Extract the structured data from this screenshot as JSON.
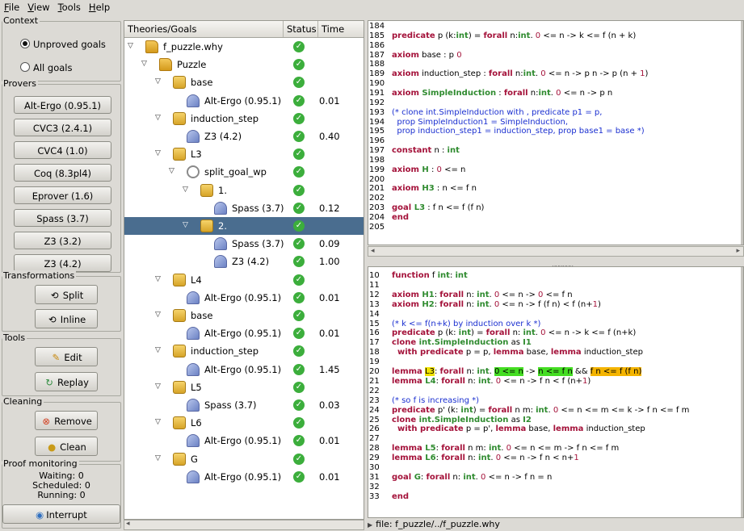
{
  "menu": [
    "File",
    "View",
    "Tools",
    "Help"
  ],
  "context": {
    "title": "Context",
    "options": [
      {
        "label": "Unproved goals",
        "selected": true
      },
      {
        "label": "All goals",
        "selected": false
      }
    ]
  },
  "provers": {
    "title": "Provers",
    "buttons": [
      "Alt-Ergo (0.95.1)",
      "CVC3 (2.4.1)",
      "CVC4 (1.0)",
      "Coq (8.3pl4)",
      "Eprover (1.6)",
      "Spass (3.7)",
      "Z3 (3.2)",
      "Z3 (4.2)"
    ]
  },
  "transformations": {
    "title": "Transformations",
    "buttons": [
      {
        "label": "Split",
        "icon": "split-icon"
      },
      {
        "label": "Inline",
        "icon": "inline-icon"
      }
    ]
  },
  "tools": {
    "title": "Tools",
    "buttons": [
      {
        "label": "Edit",
        "icon": "pencil-icon"
      },
      {
        "label": "Replay",
        "icon": "replay-icon"
      }
    ]
  },
  "cleaning": {
    "title": "Cleaning",
    "buttons": [
      {
        "label": "Remove",
        "icon": "remove-icon"
      },
      {
        "label": "Clean",
        "icon": "clean-icon"
      }
    ]
  },
  "monitor": {
    "title": "Proof monitoring",
    "waiting": "Waiting: 0",
    "scheduled": "Scheduled: 0",
    "running": "Running: 0",
    "interrupt": "Interrupt"
  },
  "tree": {
    "headers": [
      "Theories/Goals",
      "Status",
      "Time"
    ],
    "rows": [
      {
        "label": "f_puzzle.why",
        "icon": "folder-icon",
        "depth": 0,
        "expander": "▽",
        "time": ""
      },
      {
        "label": "Puzzle",
        "icon": "folder-icon",
        "depth": 1,
        "expander": "▽",
        "time": ""
      },
      {
        "label": "base",
        "icon": "lock-icon",
        "depth": 2,
        "expander": "▽",
        "time": ""
      },
      {
        "label": "Alt-Ergo (0.95.1)",
        "icon": "prover-icon",
        "depth": 3,
        "expander": "",
        "time": "0.01"
      },
      {
        "label": "induction_step",
        "icon": "lock-icon",
        "depth": 2,
        "expander": "▽",
        "time": ""
      },
      {
        "label": "Z3 (4.2)",
        "icon": "prover-icon",
        "depth": 3,
        "expander": "",
        "time": "0.40"
      },
      {
        "label": "L3",
        "icon": "lock-icon",
        "depth": 2,
        "expander": "▽",
        "time": ""
      },
      {
        "label": "split_goal_wp",
        "icon": "split-icon",
        "depth": 3,
        "expander": "▽",
        "time": ""
      },
      {
        "label": "1.",
        "icon": "lock-icon",
        "depth": 4,
        "expander": "▽",
        "time": ""
      },
      {
        "label": "Spass (3.7)",
        "icon": "prover-icon",
        "depth": 5,
        "expander": "",
        "time": "0.12"
      },
      {
        "label": "2.",
        "icon": "lock-icon",
        "depth": 4,
        "expander": "▽",
        "time": "",
        "selected": true
      },
      {
        "label": "Spass (3.7)",
        "icon": "prover-icon",
        "depth": 5,
        "expander": "",
        "time": "0.09"
      },
      {
        "label": "Z3 (4.2)",
        "icon": "prover-icon",
        "depth": 5,
        "expander": "",
        "time": "1.00"
      },
      {
        "label": "L4",
        "icon": "lock-icon",
        "depth": 2,
        "expander": "▽",
        "time": ""
      },
      {
        "label": "Alt-Ergo (0.95.1)",
        "icon": "prover-icon",
        "depth": 3,
        "expander": "",
        "time": "0.01"
      },
      {
        "label": "base",
        "icon": "lock-icon",
        "depth": 2,
        "expander": "▽",
        "time": ""
      },
      {
        "label": "Alt-Ergo (0.95.1)",
        "icon": "prover-icon",
        "depth": 3,
        "expander": "",
        "time": "0.01"
      },
      {
        "label": "induction_step",
        "icon": "lock-icon",
        "depth": 2,
        "expander": "▽",
        "time": ""
      },
      {
        "label": "Alt-Ergo (0.95.1)",
        "icon": "prover-icon",
        "depth": 3,
        "expander": "",
        "time": "1.45"
      },
      {
        "label": "L5",
        "icon": "lock-icon",
        "depth": 2,
        "expander": "▽",
        "time": ""
      },
      {
        "label": "Spass (3.7)",
        "icon": "prover-icon",
        "depth": 3,
        "expander": "",
        "time": "0.03"
      },
      {
        "label": "L6",
        "icon": "lock-icon",
        "depth": 2,
        "expander": "▽",
        "time": ""
      },
      {
        "label": "Alt-Ergo (0.95.1)",
        "icon": "prover-icon",
        "depth": 3,
        "expander": "",
        "time": "0.01"
      },
      {
        "label": "G",
        "icon": "lock-icon",
        "depth": 2,
        "expander": "▽",
        "time": ""
      },
      {
        "label": "Alt-Ergo (0.95.1)",
        "icon": "prover-icon",
        "depth": 3,
        "expander": "",
        "time": "0.01"
      }
    ]
  },
  "task_view": {
    "lines": [
      {
        "n": "184",
        "segs": []
      },
      {
        "n": "185",
        "segs": [
          [
            "k",
            "predicate"
          ],
          [
            "d",
            " p (k:"
          ],
          [
            "t",
            "int"
          ],
          [
            "d",
            ") = "
          ],
          [
            "k",
            "forall"
          ],
          [
            "d",
            " n:"
          ],
          [
            "t",
            "int"
          ],
          [
            "d",
            ". "
          ],
          [
            "nm",
            "0"
          ],
          [
            "d",
            " <= n -> k <= f (n + k)"
          ]
        ]
      },
      {
        "n": "186",
        "segs": []
      },
      {
        "n": "187",
        "segs": [
          [
            "k",
            "axiom"
          ],
          [
            "d",
            " base : p "
          ],
          [
            "nm",
            "0"
          ]
        ]
      },
      {
        "n": "188",
        "segs": []
      },
      {
        "n": "189",
        "segs": [
          [
            "k",
            "axiom"
          ],
          [
            "d",
            " induction_step : "
          ],
          [
            "k",
            "forall"
          ],
          [
            "d",
            " n:"
          ],
          [
            "t",
            "int"
          ],
          [
            "d",
            ". "
          ],
          [
            "nm",
            "0"
          ],
          [
            "d",
            " <= n -> p n -> p (n + "
          ],
          [
            "nm",
            "1"
          ],
          [
            "d",
            ")"
          ]
        ]
      },
      {
        "n": "190",
        "segs": []
      },
      {
        "n": "191",
        "segs": [
          [
            "k",
            "axiom"
          ],
          [
            "t",
            " SimpleInduction"
          ],
          [
            "d",
            " : "
          ],
          [
            "k",
            "forall"
          ],
          [
            "d",
            " n:"
          ],
          [
            "t",
            "int"
          ],
          [
            "d",
            ". "
          ],
          [
            "nm",
            "0"
          ],
          [
            "d",
            " <= n -> p n"
          ]
        ]
      },
      {
        "n": "192",
        "segs": []
      },
      {
        "n": "193",
        "segs": [
          [
            "cm",
            "(* clone int.SimpleInduction with , predicate p1 = p,"
          ]
        ]
      },
      {
        "n": "194",
        "segs": [
          [
            "cm",
            "  prop SimpleInduction1 = SimpleInduction,"
          ]
        ]
      },
      {
        "n": "195",
        "segs": [
          [
            "cm",
            "  prop induction_step1 = induction_step, prop base1 = base *)"
          ]
        ]
      },
      {
        "n": "196",
        "segs": []
      },
      {
        "n": "197",
        "segs": [
          [
            "k",
            "constant"
          ],
          [
            "d",
            " n : "
          ],
          [
            "t",
            "int"
          ]
        ]
      },
      {
        "n": "198",
        "segs": []
      },
      {
        "n": "199",
        "segs": [
          [
            "k",
            "axiom"
          ],
          [
            "t",
            " H"
          ],
          [
            "d",
            " : "
          ],
          [
            "nm",
            "0"
          ],
          [
            "d",
            " <= n"
          ]
        ]
      },
      {
        "n": "200",
        "segs": []
      },
      {
        "n": "201",
        "segs": [
          [
            "k",
            "axiom"
          ],
          [
            "t",
            " H3"
          ],
          [
            "d",
            " : n <= f n"
          ]
        ]
      },
      {
        "n": "202",
        "segs": []
      },
      {
        "n": "203",
        "segs": [
          [
            "k",
            "goal"
          ],
          [
            "t",
            " L3"
          ],
          [
            "d",
            " : f n <= f (f n)"
          ]
        ]
      },
      {
        "n": "204",
        "segs": [
          [
            "k",
            "end"
          ]
        ]
      },
      {
        "n": "205",
        "segs": []
      }
    ]
  },
  "source_view": {
    "lines": [
      {
        "n": "10",
        "segs": [
          [
            "k",
            "function"
          ],
          [
            "d",
            " f "
          ],
          [
            "t",
            "int"
          ],
          [
            "d",
            ": "
          ],
          [
            "t",
            "int"
          ]
        ]
      },
      {
        "n": "11",
        "segs": []
      },
      {
        "n": "12",
        "segs": [
          [
            "k",
            "axiom"
          ],
          [
            "t",
            " H1"
          ],
          [
            "d",
            ": "
          ],
          [
            "k",
            "forall"
          ],
          [
            "d",
            " n: "
          ],
          [
            "t",
            "int"
          ],
          [
            "d",
            ". "
          ],
          [
            "nm",
            "0"
          ],
          [
            "d",
            " <= n -> "
          ],
          [
            "nm",
            "0"
          ],
          [
            "d",
            " <= f n"
          ]
        ]
      },
      {
        "n": "13",
        "segs": [
          [
            "k",
            "axiom"
          ],
          [
            "t",
            " H2"
          ],
          [
            "d",
            ": "
          ],
          [
            "k",
            "forall"
          ],
          [
            "d",
            " n: "
          ],
          [
            "t",
            "int"
          ],
          [
            "d",
            ". "
          ],
          [
            "nm",
            "0"
          ],
          [
            "d",
            " <= n -> f (f n) < f (n+"
          ],
          [
            "nm",
            "1"
          ],
          [
            "d",
            ")"
          ]
        ]
      },
      {
        "n": "14",
        "segs": []
      },
      {
        "n": "15",
        "segs": [
          [
            "cm",
            "(* k <= f(n+k) by induction over k *)"
          ]
        ]
      },
      {
        "n": "16",
        "segs": [
          [
            "k",
            "predicate"
          ],
          [
            "d",
            " p (k: "
          ],
          [
            "t",
            "int"
          ],
          [
            "d",
            ") = "
          ],
          [
            "k",
            "forall"
          ],
          [
            "d",
            " n: "
          ],
          [
            "t",
            "int"
          ],
          [
            "d",
            ". "
          ],
          [
            "nm",
            "0"
          ],
          [
            "d",
            " <= n -> k <= f (n+k)"
          ]
        ]
      },
      {
        "n": "17",
        "segs": [
          [
            "k",
            "clone"
          ],
          [
            "t",
            " int.SimpleInduction"
          ],
          [
            "d",
            " as "
          ],
          [
            "t",
            "I1"
          ]
        ]
      },
      {
        "n": "18",
        "segs": [
          [
            "k",
            "  with predicate"
          ],
          [
            "d",
            " p = p, "
          ],
          [
            "k",
            "lemma"
          ],
          [
            "d",
            " base, "
          ],
          [
            "k",
            "lemma"
          ],
          [
            "d",
            " induction_step"
          ]
        ]
      },
      {
        "n": "19",
        "segs": []
      },
      {
        "n": "20",
        "segs": [
          [
            "k",
            "lemma"
          ],
          [
            "d",
            " "
          ],
          [
            "hY",
            "L3"
          ],
          [
            "d",
            ": "
          ],
          [
            "k",
            "forall"
          ],
          [
            "d",
            " n: "
          ],
          [
            "t",
            "int"
          ],
          [
            "d",
            ". "
          ],
          [
            "hG",
            "0 <= n"
          ],
          [
            "d",
            " -> "
          ],
          [
            "hG",
            "n <= f n"
          ],
          [
            "d",
            " && "
          ],
          [
            "hO",
            "f n <= f (f n)"
          ]
        ]
      },
      {
        "n": "21",
        "segs": [
          [
            "k",
            "lemma"
          ],
          [
            "t",
            " L4"
          ],
          [
            "d",
            ": "
          ],
          [
            "k",
            "forall"
          ],
          [
            "d",
            " n: "
          ],
          [
            "t",
            "int"
          ],
          [
            "d",
            ". "
          ],
          [
            "nm",
            "0"
          ],
          [
            "d",
            " <= n -> f n < f (n+"
          ],
          [
            "nm",
            "1"
          ],
          [
            "d",
            ")"
          ]
        ]
      },
      {
        "n": "22",
        "segs": []
      },
      {
        "n": "23",
        "segs": [
          [
            "cm",
            "(* so f is increasing *)"
          ]
        ]
      },
      {
        "n": "24",
        "segs": [
          [
            "k",
            "predicate"
          ],
          [
            "d",
            " p' (k: "
          ],
          [
            "t",
            "int"
          ],
          [
            "d",
            ") = "
          ],
          [
            "k",
            "forall"
          ],
          [
            "d",
            " n m: "
          ],
          [
            "t",
            "int"
          ],
          [
            "d",
            ". "
          ],
          [
            "nm",
            "0"
          ],
          [
            "d",
            " <= n <= m <= k -> f n <= f m"
          ]
        ]
      },
      {
        "n": "25",
        "segs": [
          [
            "k",
            "clone"
          ],
          [
            "t",
            " int.SimpleInduction"
          ],
          [
            "d",
            " as "
          ],
          [
            "t",
            "I2"
          ]
        ]
      },
      {
        "n": "26",
        "segs": [
          [
            "k",
            "  with predicate"
          ],
          [
            "d",
            " p = p', "
          ],
          [
            "k",
            "lemma"
          ],
          [
            "d",
            " base, "
          ],
          [
            "k",
            "lemma"
          ],
          [
            "d",
            " induction_step"
          ]
        ]
      },
      {
        "n": "27",
        "segs": []
      },
      {
        "n": "28",
        "segs": [
          [
            "k",
            "lemma"
          ],
          [
            "t",
            " L5"
          ],
          [
            "d",
            ": "
          ],
          [
            "k",
            "forall"
          ],
          [
            "d",
            " n m: "
          ],
          [
            "t",
            "int"
          ],
          [
            "d",
            ". "
          ],
          [
            "nm",
            "0"
          ],
          [
            "d",
            " <= n <= m -> f n <= f m"
          ]
        ]
      },
      {
        "n": "29",
        "segs": [
          [
            "k",
            "lemma"
          ],
          [
            "t",
            " L6"
          ],
          [
            "d",
            ": "
          ],
          [
            "k",
            "forall"
          ],
          [
            "d",
            " n: "
          ],
          [
            "t",
            "int"
          ],
          [
            "d",
            ". "
          ],
          [
            "nm",
            "0"
          ],
          [
            "d",
            " <= n -> f n < n+"
          ],
          [
            "nm",
            "1"
          ]
        ]
      },
      {
        "n": "30",
        "segs": []
      },
      {
        "n": "31",
        "segs": [
          [
            "k",
            "goal"
          ],
          [
            "t",
            " G"
          ],
          [
            "d",
            ": "
          ],
          [
            "k",
            "forall"
          ],
          [
            "d",
            " n: "
          ],
          [
            "t",
            "int"
          ],
          [
            "d",
            ". "
          ],
          [
            "nm",
            "0"
          ],
          [
            "d",
            " <= n -> f n = n"
          ]
        ]
      },
      {
        "n": "32",
        "segs": []
      },
      {
        "n": "33",
        "segs": [
          [
            "k",
            "end"
          ]
        ]
      }
    ]
  },
  "statusbar": {
    "file": "file: f_puzzle/../f_puzzle.why"
  }
}
